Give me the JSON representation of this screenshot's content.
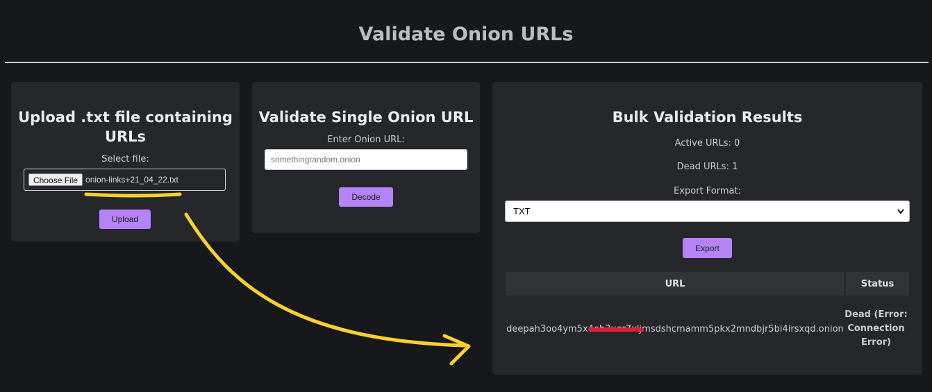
{
  "page": {
    "title": "Validate Onion URLs"
  },
  "upload": {
    "heading": "Upload .txt file containing URLs",
    "select_label": "Select file:",
    "choose_file_label": "Choose File",
    "file_name": "onion-links+21_04_22.txt",
    "upload_label": "Upload"
  },
  "single": {
    "heading": "Validate Single Onion URL",
    "input_label": "Enter Onion URL:",
    "placeholder": "somethingrandom.onion",
    "decode_label": "Decode"
  },
  "results": {
    "heading": "Bulk Validation Results",
    "active_urls": "Active URLs: 0",
    "dead_urls": "Dead URLs: 1",
    "export_format_label": "Export Format:",
    "export_format_value": "TXT",
    "export_label": "Export",
    "table": {
      "headers": [
        "URL",
        "Status"
      ],
      "rows": [
        {
          "url": "deepah3oo4ym5x4oh3uer7xljmsdshcmamm5pkx2mndbjr5bi4irsxqd.onion",
          "status": "Dead (Error: Connection Error)"
        }
      ]
    }
  },
  "colors": {
    "background": "#17181b",
    "card": "#25272b",
    "accent_button": "#b583f5",
    "annotation": "#fbd22b",
    "redaction": "#e2203a"
  }
}
